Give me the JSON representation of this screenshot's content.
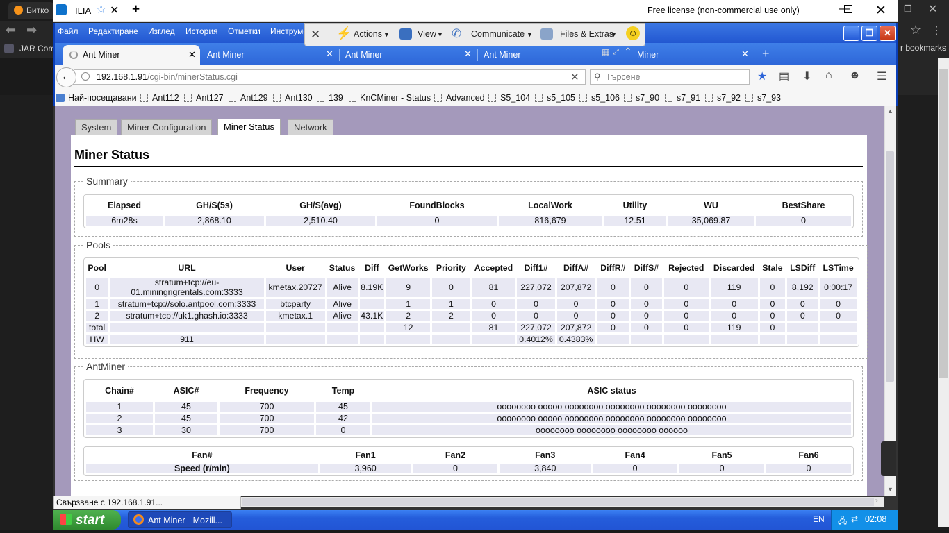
{
  "outer_browser": {
    "tab_title": "Битко",
    "bookmark_partial": "JAR Com",
    "right_bookmarks": "r bookmarks"
  },
  "teamviewer": {
    "tab_title": "ILIA",
    "license": "Free license (non-commercial use only)",
    "panel": {
      "actions": "Actions",
      "view": "View",
      "communicate": "Communicate",
      "files": "Files & Extras"
    }
  },
  "firefox": {
    "menu": [
      "Файл",
      "Редактиране",
      "Изглед",
      "История",
      "Отметки",
      "Инструме"
    ],
    "tabs": [
      "Ant Miner",
      "Ant Miner",
      "Ant Miner",
      "Ant Miner",
      "Miner"
    ],
    "url_host": "192.168.1.91",
    "url_path": "/cgi-bin/minerStatus.cgi",
    "search_placeholder": "Търсене",
    "bookmarks": [
      "Най-посещавани",
      "Ant112",
      "Ant127",
      "Ant129",
      "Ant130",
      "139",
      "KnCMiner - Status",
      "Advanced",
      "S5_104",
      "s5_105",
      "s5_106",
      "s7_90",
      "s7_91",
      "s7_92",
      "s7_93"
    ],
    "status_text": "Свързване с 192.168.1.91..."
  },
  "page": {
    "subtabs": [
      "System",
      "Miner Configuration",
      "Miner Status",
      "Network"
    ],
    "title": "Miner Status",
    "summary": {
      "legend": "Summary",
      "headers": [
        "Elapsed",
        "GH/S(5s)",
        "GH/S(avg)",
        "FoundBlocks",
        "LocalWork",
        "Utility",
        "WU",
        "BestShare"
      ],
      "values": [
        "6m28s",
        "2,868.10",
        "2,510.40",
        "0",
        "816,679",
        "12.51",
        "35,069.87",
        "0"
      ]
    },
    "pools": {
      "legend": "Pools",
      "headers": [
        "Pool",
        "URL",
        "User",
        "Status",
        "Diff",
        "GetWorks",
        "Priority",
        "Accepted",
        "Diff1#",
        "DiffA#",
        "DiffR#",
        "DiffS#",
        "Rejected",
        "Discarded",
        "Stale",
        "LSDiff",
        "LSTime"
      ],
      "rows": [
        [
          "0",
          "stratum+tcp://eu-01.miningrigrentals.com:3333",
          "kmetax.20727",
          "Alive",
          "8.19K",
          "9",
          "0",
          "81",
          "227,072",
          "207,872",
          "0",
          "0",
          "0",
          "119",
          "0",
          "8,192",
          "0:00:17"
        ],
        [
          "1",
          "stratum+tcp://solo.antpool.com:3333",
          "btcparty",
          "Alive",
          "",
          "1",
          "1",
          "0",
          "0",
          "0",
          "0",
          "0",
          "0",
          "0",
          "0",
          "0",
          "0"
        ],
        [
          "2",
          "stratum+tcp://uk1.ghash.io:3333",
          "kmetax.1",
          "Alive",
          "43.1K",
          "2",
          "2",
          "0",
          "0",
          "0",
          "0",
          "0",
          "0",
          "0",
          "0",
          "0",
          "0"
        ],
        [
          "total",
          "",
          "",
          "",
          "",
          "12",
          "",
          "81",
          "227,072",
          "207,872",
          "0",
          "0",
          "0",
          "119",
          "0",
          "",
          ""
        ],
        [
          "HW",
          "911",
          "",
          "",
          "",
          "",
          "",
          "",
          "0.4012%",
          "0.4383%",
          "",
          "",
          "",
          "",
          "",
          "",
          ""
        ]
      ]
    },
    "antminer": {
      "legend": "AntMiner",
      "chain_headers": [
        "Chain#",
        "ASIC#",
        "Frequency",
        "Temp",
        "ASIC status"
      ],
      "chains": [
        [
          "1",
          "45",
          "700",
          "45",
          "oooooooo ooooo oooooooo oooooooo oooooooo oooooooo"
        ],
        [
          "2",
          "45",
          "700",
          "42",
          "oooooooo ooooo oooooooo oooooooo oooooooo oooooooo"
        ],
        [
          "3",
          "30",
          "700",
          "0",
          "oooooooo oooooooo oooooooo oooooo"
        ]
      ],
      "fan_headers": [
        "Fan#",
        "Fan1",
        "Fan2",
        "Fan3",
        "Fan4",
        "Fan5",
        "Fan6"
      ],
      "fan_row": [
        "Speed (r/min)",
        "3,960",
        "0",
        "3,840",
        "0",
        "0",
        "0"
      ]
    }
  },
  "taskbar": {
    "start": "start",
    "task": "Ant Miner - Mozill...",
    "lang": "EN",
    "clock": "02:08"
  }
}
